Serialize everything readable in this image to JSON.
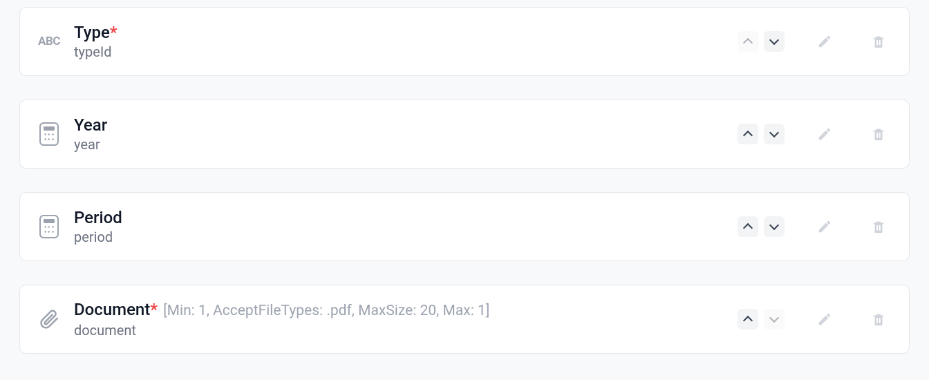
{
  "fields": [
    {
      "icon": "abc",
      "label": "Type",
      "required": true,
      "id": "typeId",
      "hint": "",
      "upDisabled": true,
      "downDisabled": false
    },
    {
      "icon": "calc",
      "label": "Year",
      "required": false,
      "id": "year",
      "hint": "",
      "upDisabled": false,
      "downDisabled": false
    },
    {
      "icon": "calc",
      "label": "Period",
      "required": false,
      "id": "period",
      "hint": "",
      "upDisabled": false,
      "downDisabled": false
    },
    {
      "icon": "clip",
      "label": "Document",
      "required": true,
      "id": "document",
      "hint": "[Min: 1, AcceptFileTypes: .pdf, MaxSize: 20, Max: 1]",
      "upDisabled": false,
      "downDisabled": true
    }
  ],
  "iconText": {
    "abc": "ABC"
  }
}
